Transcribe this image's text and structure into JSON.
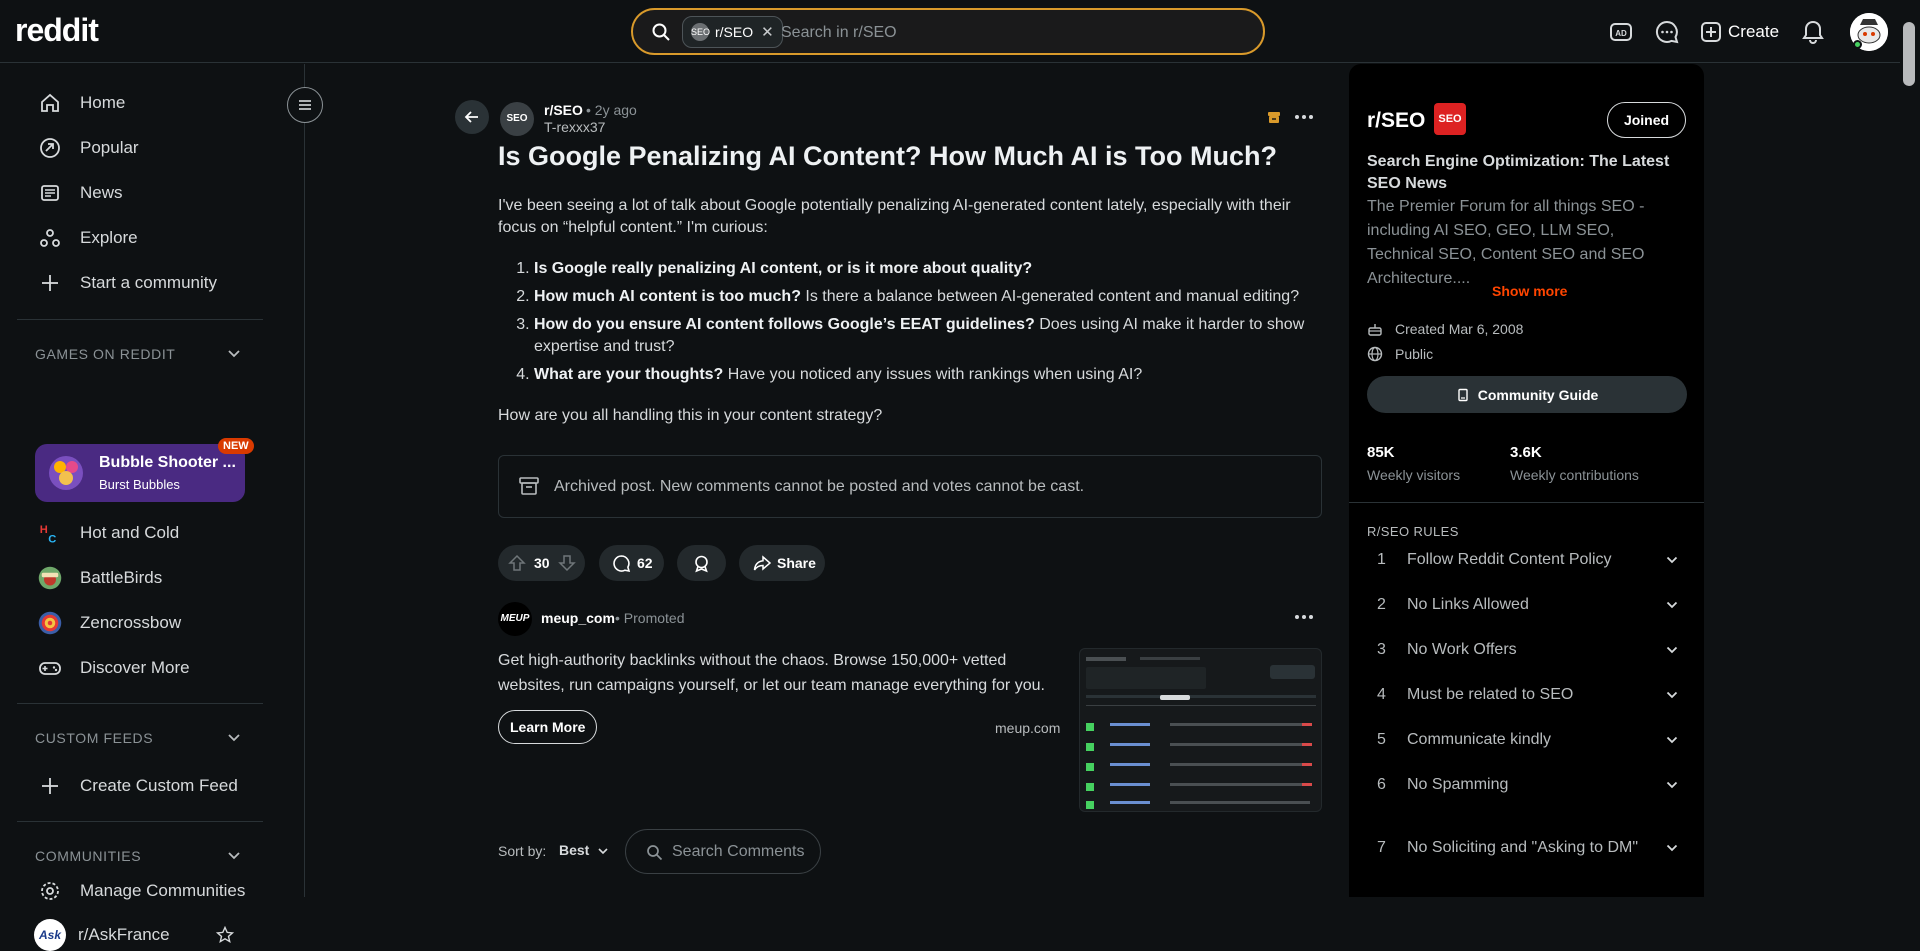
{
  "header": {
    "logo": "reddit",
    "search": {
      "chip_label": "r/SEO",
      "chip_avatar_text": "SEO",
      "placeholder": "Search in r/SEO"
    },
    "create_label": "Create"
  },
  "sidebar": {
    "nav": [
      "Home",
      "Popular",
      "News",
      "Explore",
      "Start a community"
    ],
    "games_heading": "GAMES ON REDDIT",
    "featured_game": {
      "title": "Bubble Shooter ...",
      "subtitle": "Burst Bubbles",
      "badge": "NEW"
    },
    "games": [
      "Hot and Cold",
      "BattleBirds",
      "Zencrossbow",
      "Discover More"
    ],
    "custom_feeds_heading": "CUSTOM FEEDS",
    "create_custom_feed": "Create Custom Feed",
    "communities_heading": "COMMUNITIES",
    "manage_communities": "Manage Communities",
    "community": {
      "name": "r/AskFrance",
      "avatar_text": "Ask"
    }
  },
  "post": {
    "subreddit": "r/SEO",
    "age": "• 2y ago",
    "author": "T-rexxx37",
    "title": "Is Google Penalizing AI Content? How Much AI is Too Much?",
    "intro": "I've been seeing a lot of talk about Google potentially penalizing AI-generated content lately, especially with their focus on “helpful content.” I'm curious:",
    "points": [
      {
        "bold": "Is Google really penalizing AI content, or is it more about quality?",
        "rest": ""
      },
      {
        "bold": "How much AI content is too much?",
        "rest": " Is there a balance between AI-generated content and manual editing?"
      },
      {
        "bold": "How do you ensure AI content follows Google’s EEAT guidelines?",
        "rest": " Does using AI make it harder to show expertise and trust?"
      },
      {
        "bold": "What are your thoughts?",
        "rest": " Have you noticed any issues with rankings when using AI?"
      }
    ],
    "question": "How are you all handling this in your content strategy?",
    "archived_notice": "Archived post. New comments cannot be posted and votes cannot be cast.",
    "votes": "30",
    "comments": "62",
    "share_label": "Share"
  },
  "promoted": {
    "avatar_text": "MEUP",
    "name": "meup_com",
    "tag": "• Promoted",
    "text": "Get high-authority backlinks without the chaos. Browse 150,000+ vetted websites, run campaigns yourself, or let our team manage everything for you.",
    "cta": "Learn More",
    "domain": "meup.com"
  },
  "comments_bar": {
    "sort_label": "Sort by:",
    "sort_value": "Best",
    "search_placeholder": "Search Comments"
  },
  "community_panel": {
    "name": "r/SEO",
    "banner_text": "SEO",
    "joined_label": "Joined",
    "heading": "Search Engine Optimization: The Latest SEO News",
    "description": "The Premier Forum for all things SEO - including AI SEO, GEO, LLM SEO, Technical SEO, Content SEO and SEO Architecture....",
    "show_more": "Show more",
    "created": "Created Mar 6, 2008",
    "visibility": "Public",
    "guide_label": "Community Guide",
    "stats": [
      {
        "value": "85K",
        "label": "Weekly visitors"
      },
      {
        "value": "3.6K",
        "label": "Weekly contributions"
      }
    ],
    "rules_heading": "R/SEO RULES",
    "rules": [
      {
        "n": "1",
        "text": "Follow Reddit Content Policy"
      },
      {
        "n": "2",
        "text": "No Links Allowed"
      },
      {
        "n": "3",
        "text": "No Work Offers"
      },
      {
        "n": "4",
        "text": "Must be related to SEO"
      },
      {
        "n": "5",
        "text": "Communicate kindly"
      },
      {
        "n": "6",
        "text": "No Spamming"
      },
      {
        "n": "7",
        "text": "No Soliciting and \"Asking to DM\""
      }
    ]
  },
  "colors": {
    "accent": "#ff4500",
    "background": "#0e1113",
    "promo_card": "#4a2a82",
    "search_border": "#d99a2b"
  }
}
